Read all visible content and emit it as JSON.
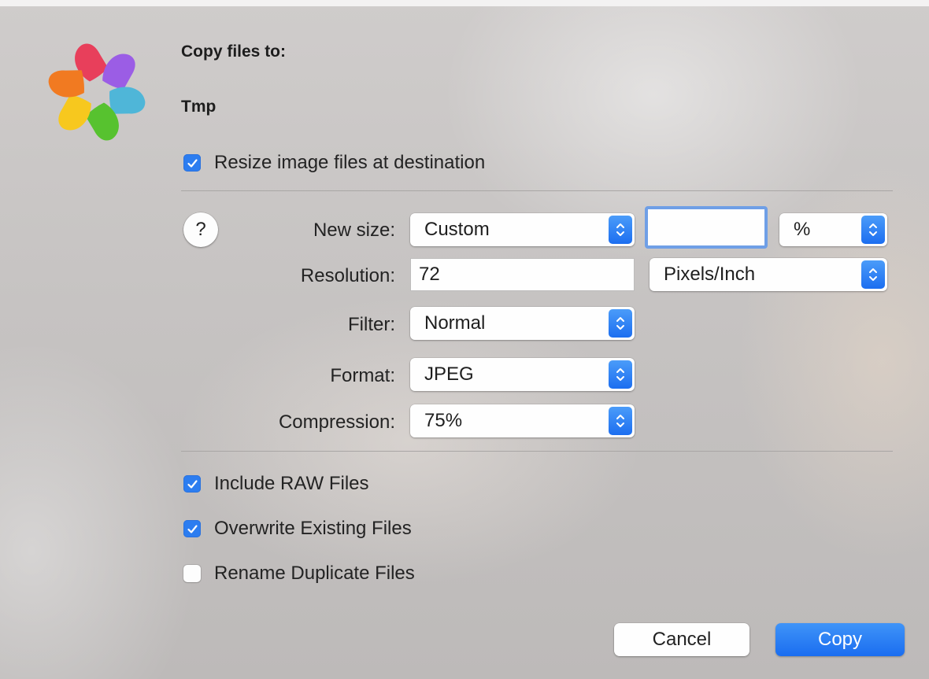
{
  "dialog": {
    "title": "Copy files to:",
    "destination": "Tmp"
  },
  "resize": {
    "label": "Resize image files at destination",
    "checked": true
  },
  "help": {
    "glyph": "?"
  },
  "settings": {
    "new_size": {
      "label": "New size:",
      "preset": "Custom",
      "value": "",
      "unit": "%"
    },
    "resolution": {
      "label": "Resolution:",
      "value": "72",
      "unit": "Pixels/Inch"
    },
    "filter": {
      "label": "Filter:",
      "value": "Normal"
    },
    "format": {
      "label": "Format:",
      "value": "JPEG"
    },
    "compression": {
      "label": "Compression:",
      "value": "75%"
    }
  },
  "options": [
    {
      "label": "Include RAW Files",
      "checked": true
    },
    {
      "label": "Overwrite Existing Files",
      "checked": true
    },
    {
      "label": "Rename Duplicate Files",
      "checked": false
    }
  ],
  "buttons": {
    "cancel": "Cancel",
    "copy": "Copy"
  },
  "colors": {
    "accent": "#2c7df0",
    "logo": [
      "#e83f5b",
      "#9b5de5",
      "#4fb6d8",
      "#57c22f",
      "#f7c81e",
      "#f17a21"
    ]
  },
  "icons": [
    "app-logo",
    "checkmark-icon",
    "help-icon",
    "updown-chevron-icon"
  ]
}
